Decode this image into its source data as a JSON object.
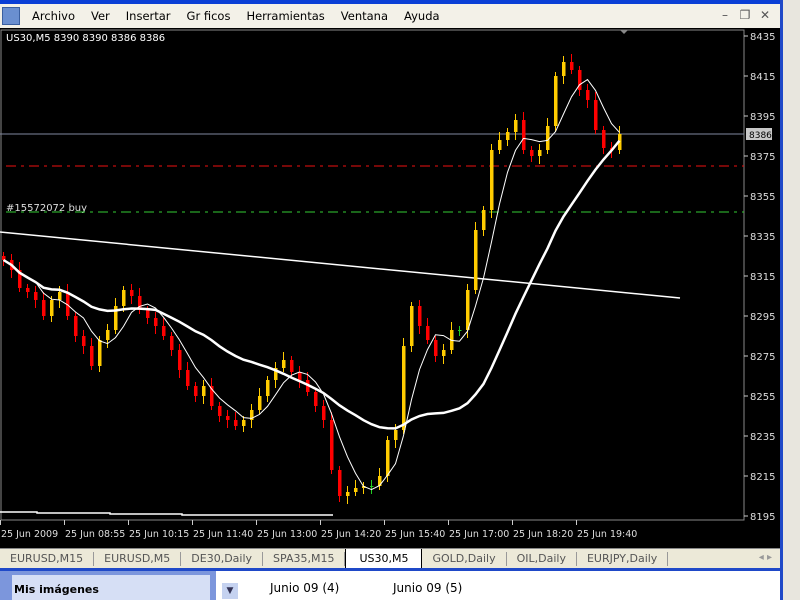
{
  "menu": {
    "items": [
      "Archivo",
      "Ver",
      "Insertar",
      "Gr ficos",
      "Herramientas",
      "Ventana",
      "Ayuda"
    ]
  },
  "window_buttons": {
    "minimize": "–",
    "restore": "❐",
    "close": "✕"
  },
  "chart": {
    "header": "US30,M5  8390 8390 8386 8386",
    "current_price_label": "8386",
    "order_label": "#15572072 buy",
    "colors": {
      "bull": "#ffcc00",
      "bear": "#ff0000",
      "doji": "#22cc22",
      "ma": "#ffffff",
      "order_line": "#33cc33",
      "stop_line": "#ee1111",
      "price_line": "#8088a0"
    }
  },
  "chart_data": {
    "type": "candlestick",
    "ylim": [
      8190,
      8440
    ],
    "yticks": [
      "8435",
      "8415",
      "8395",
      "8375",
      "8355",
      "8335",
      "8315",
      "8295",
      "8275",
      "8255",
      "8235",
      "8215",
      "8195"
    ],
    "xticks": [
      "25 Jun 2009",
      "25 Jun 08:55",
      "25 Jun 10:15",
      "25 Jun 11:40",
      "25 Jun 13:00",
      "25 Jun 14:20",
      "25 Jun 15:40",
      "25 Jun 17:00",
      "25 Jun 18:20",
      "25 Jun 19:40"
    ],
    "first_open": 8325,
    "closes": [
      8323,
      8318,
      8309,
      8307,
      8303,
      8295,
      8303,
      8307,
      8295,
      8285,
      8280,
      8270,
      8283,
      8288,
      8300,
      8308,
      8305,
      8298,
      8294,
      8290,
      8285,
      8278,
      8268,
      8260,
      8255,
      8260,
      8250,
      8245,
      8243,
      8240,
      8243,
      8248,
      8255,
      8263,
      8269,
      8273,
      8267,
      8263,
      8257,
      8250,
      8243,
      8218,
      8205,
      8207,
      8209,
      8210,
      8210,
      8215,
      8233,
      8238,
      8280,
      8300,
      8290,
      8283,
      8275,
      8278,
      8288,
      8288,
      8308,
      8338,
      8348,
      8378,
      8383,
      8387,
      8393,
      8378,
      8375,
      8378,
      8390,
      8415,
      8422,
      8418,
      8408,
      8403,
      8388,
      8379,
      8378,
      8386
    ],
    "current_price": 8386,
    "order_buy_price": 8347,
    "stop_line_price": 8370,
    "trendline": {
      "from": 8337,
      "to": 8304
    },
    "moving_averages": [
      {
        "period": 5
      },
      {
        "period": 20
      }
    ]
  },
  "tabs": [
    "EURUSD,M15",
    "EURUSD,M5",
    "DE30,Daily",
    "SPA35,M15",
    "US30,M5",
    "GOLD,Daily",
    "OIL,Daily",
    "EURJPY,Daily"
  ],
  "active_tab": "US30,M5",
  "bottom": {
    "sidebar_label": "Mis imágenes",
    "folders": [
      "Junio 09 (4)",
      "Junio 09  (5)"
    ]
  }
}
